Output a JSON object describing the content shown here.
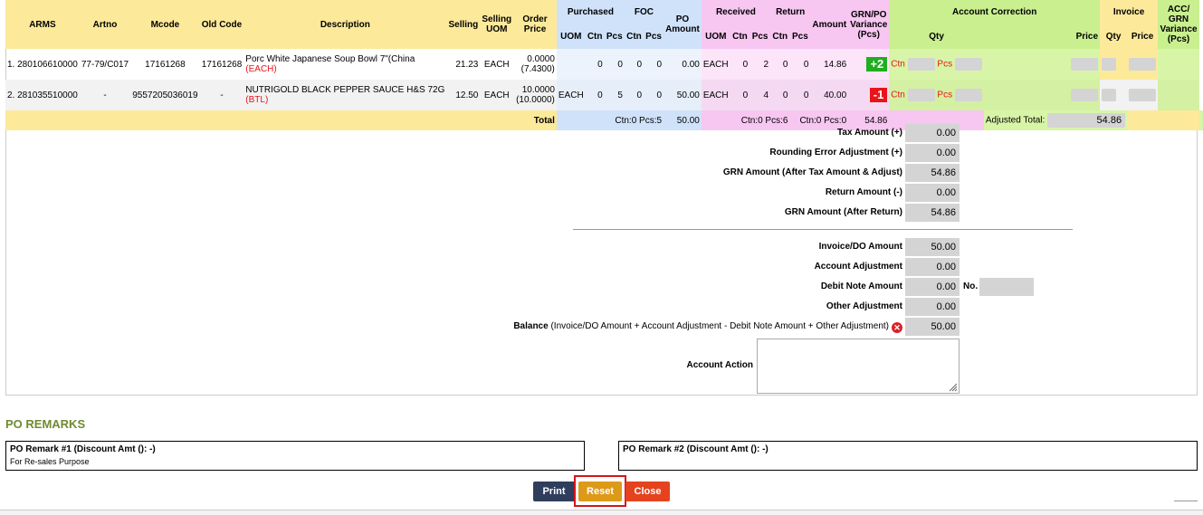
{
  "header": {
    "arms": "ARMS",
    "artno": "Artno",
    "mcode": "Mcode",
    "old_code": "Old Code",
    "description": "Description",
    "selling": "Selling",
    "selling_uom": "Selling UOM",
    "order_price": "Order Price",
    "purchased": "Purchased",
    "foc": "FOC",
    "po_amount": "PO Amount",
    "received": "Received",
    "return": "Return",
    "amount": "Amount",
    "variance": "GRN/PO Variance (Pcs)",
    "account_correction": "Account Correction",
    "invoice": "Invoice",
    "acc_variance": "ACC/ GRN Variance (Pcs)",
    "uom": "UOM",
    "ctn": "Ctn",
    "pcs": "Pcs",
    "qty": "Qty",
    "price": "Price"
  },
  "rows": [
    {
      "arms": "1. 280106610000",
      "artno": "77-79/C017",
      "mcode": "17161268",
      "old_code": "17161268",
      "desc": "Porc White Japanese Soup Bowl 7\"(China",
      "desc_uom": "(EACH)",
      "selling": "21.23",
      "selling_uom": "EACH",
      "order_price": "0.0000",
      "order_price2": "(7.4300)",
      "p_uom": "",
      "p_ctn": "0",
      "p_pcs": "0",
      "f_ctn": "0",
      "f_pcs": "0",
      "po_amount": "0.00",
      "r_uom": "EACH",
      "r_ctn": "0",
      "r_pcs": "2",
      "ret_ctn": "0",
      "ret_pcs": "0",
      "amount": "14.86",
      "variance": "+2",
      "variance_color": "#1fae1f"
    },
    {
      "arms": "2. 281035510000",
      "artno": "-",
      "mcode": "9557205036019",
      "old_code": "-",
      "desc": "NUTRIGOLD BLACK PEPPER SAUCE H&S 72G",
      "desc_uom": "(BTL)",
      "selling": "12.50",
      "selling_uom": "EACH",
      "order_price": "10.0000",
      "order_price2": "(10.0000)",
      "p_uom": "EACH",
      "p_ctn": "0",
      "p_pcs": "5",
      "f_ctn": "0",
      "f_pcs": "0",
      "po_amount": "50.00",
      "r_uom": "EACH",
      "r_ctn": "0",
      "r_pcs": "4",
      "ret_ctn": "0",
      "ret_pcs": "0",
      "amount": "40.00",
      "variance": "-1",
      "variance_color": "#e8141a"
    }
  ],
  "correction_labels": {
    "ctn": "Ctn",
    "pcs": "Pcs"
  },
  "totals": {
    "label": "Total",
    "purchased": "Ctn:0 Pcs:5",
    "po_amount": "50.00",
    "received": "Ctn:0 Pcs:6",
    "return": "Ctn:0 Pcs:0",
    "amount": "54.86",
    "adjusted_label": "Adjusted Total:",
    "adjusted_value": "54.86"
  },
  "summary": {
    "tax_label": "Tax Amount (+)",
    "tax_value": "0.00",
    "rounding_label": "Rounding Error Adjustment (+)",
    "rounding_value": "0.00",
    "grn_label": "GRN Amount (After Tax Amount & Adjust)",
    "grn_value": "54.86",
    "return_label": "Return Amount (-)",
    "return_value": "0.00",
    "grn_after_label": "GRN Amount (After Return)",
    "grn_after_value": "54.86",
    "invoice_label": "Invoice/DO Amount",
    "invoice_value": "50.00",
    "acc_adj_label": "Account Adjustment",
    "acc_adj_value": "0.00",
    "debit_label": "Debit Note Amount",
    "debit_value": "0.00",
    "debit_no_label": "No.",
    "other_label": "Other Adjustment",
    "other_value": "0.00",
    "balance_label": "Balance",
    "balance_formula": "(Invoice/DO Amount + Account Adjustment - Debit Note Amount + Other Adjustment)",
    "balance_value": "50.00",
    "action_label": "Account Action"
  },
  "remarks": {
    "heading": "PO REMARKS",
    "r1_title": "PO Remark #1 (Discount Amt (): -)",
    "r1_text": "For Re-sales Purpose",
    "r2_title": "PO Remark #2 (Discount Amt (): -)"
  },
  "buttons": {
    "print": "Print",
    "reset": "Reset",
    "close": "Close"
  }
}
